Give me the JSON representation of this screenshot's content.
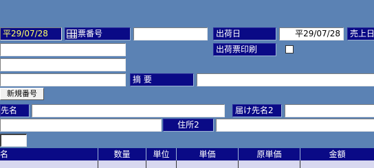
{
  "header": {
    "date_value": "平29/07/28",
    "voucher_no_label": "伝票番号",
    "voucher_no_label_visible": "票番号",
    "voucher_no_value": "",
    "ship_date_label": "出荷日",
    "ship_date_value": "平29/07/28",
    "sales_date_label": "売上日"
  },
  "row2": {
    "ship_slip_print_label": "出荷票印刷"
  },
  "row4": {
    "summary_label": "摘 要",
    "summary_value": ""
  },
  "buttons": {
    "new_number": "新規番号"
  },
  "delivery": {
    "dest1_label": "先名",
    "dest1_value": "",
    "dest2_label": "届け先名2",
    "dest2_value": "",
    "address2_label": "住所2",
    "address2_value": ""
  },
  "table": {
    "columns": [
      "名",
      "数量",
      "単位",
      "単価",
      "原単価",
      "金額"
    ]
  }
}
